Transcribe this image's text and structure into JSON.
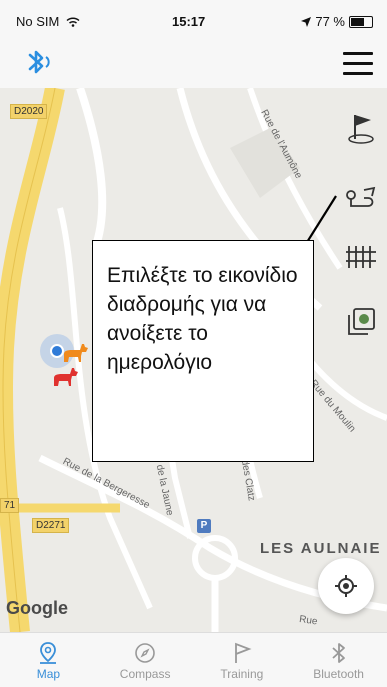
{
  "status_bar": {
    "carrier": "No SIM",
    "time": "15:17",
    "battery": "77 %",
    "battery_level": 0.77
  },
  "map": {
    "road_badges": [
      "D2020",
      "71",
      "D2271"
    ],
    "streets": [
      "Rue de l'Aumône",
      "Rue du Moulin",
      "Rue de la Bergeresse",
      "Rue de la Jaune",
      "Rue des Clatz",
      "Rue"
    ],
    "place_label": "LES AULNAIE",
    "attribution": "Google"
  },
  "callout": {
    "text": "Επιλέξτε το εικονίδιο διαδρομής για να ανοίξετε το ημερολόγιο"
  },
  "tabs": [
    {
      "label": "Map",
      "icon": "map-pin-icon",
      "active": true
    },
    {
      "label": "Compass",
      "icon": "compass-icon",
      "active": false
    },
    {
      "label": "Training",
      "icon": "flag-icon",
      "active": false
    },
    {
      "label": "Bluetooth",
      "icon": "bluetooth-icon",
      "active": false
    }
  ],
  "colors": {
    "accent": "#3a8fd8",
    "dog_orange": "#f08a1c",
    "dog_red": "#e0322f"
  }
}
